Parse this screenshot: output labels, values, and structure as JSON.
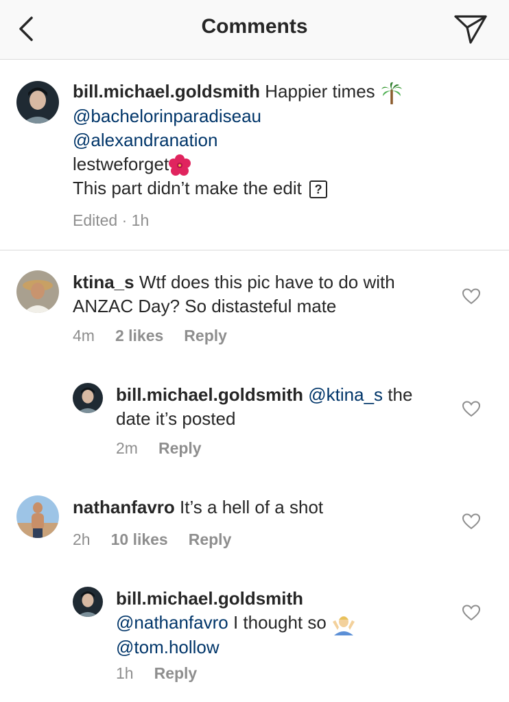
{
  "header": {
    "title": "Comments"
  },
  "caption": {
    "username": "bill.michael.goldsmith",
    "text_1": "Happier times",
    "mention_1": "@bachelorinparadiseau",
    "mention_2": "@alexandranation",
    "line_3": "lestweforget",
    "line_4": "This part didn’t make the edit",
    "unknown_glyph": "?",
    "meta": "Edited · 1h"
  },
  "comments": [
    {
      "username": "ktina_s",
      "text": "Wtf does this pic have to do with",
      "text_2": "ANZAC Day? So distasteful mate",
      "time": "4m",
      "likes": "2 likes",
      "reply": "Reply"
    },
    {
      "username": "bill.michael.goldsmith",
      "mention": "@ktina_s",
      "text": "the",
      "text_2": "date it’s posted",
      "time": "2m",
      "reply": "Reply"
    },
    {
      "username": "nathanfavro",
      "text": "It’s a hell of a shot",
      "time": "2h",
      "likes": "10 likes",
      "reply": "Reply"
    },
    {
      "username": "bill.michael.goldsmith",
      "mention": "@nathanfavro",
      "text": "I thought so",
      "mention_2": "@tom.hollow",
      "time": "1h",
      "reply": "Reply"
    }
  ],
  "icons": {
    "back": "chevron-left-icon",
    "send": "paper-plane-icon",
    "heart": "heart-outline-icon",
    "palm": "palm-tree-emoji",
    "hibiscus": "hibiscus-emoji",
    "shrug": "shrug-emoji"
  },
  "colors": {
    "mention": "#003569",
    "meta": "#8e8e8e",
    "text": "#262626",
    "divider": "#dbdbdb"
  }
}
